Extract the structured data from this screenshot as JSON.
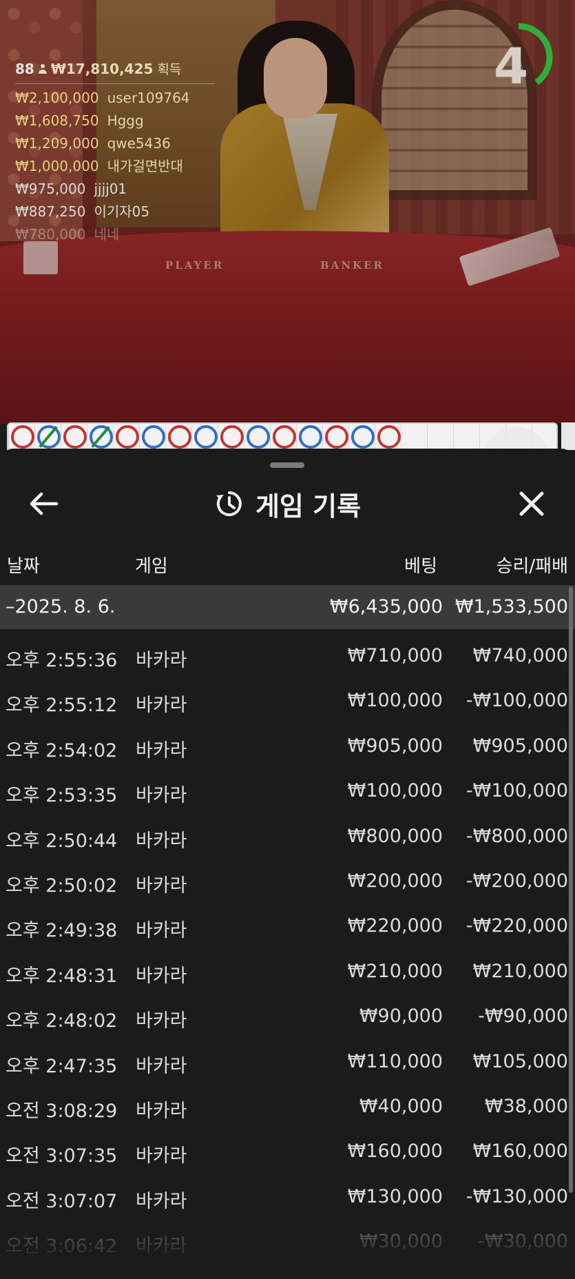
{
  "live": {
    "players_count": "88",
    "total_won": "₩17,810,425",
    "won_label": "획득",
    "countdown": "4",
    "timer_fraction": 0.4,
    "table_labels": {
      "player": "PLAYER",
      "banker": "BANKER"
    },
    "bets": [
      {
        "amount": "₩2,100,000",
        "user": "user109764"
      },
      {
        "amount": "₩1,608,750",
        "user": "Hggg"
      },
      {
        "amount": "₩1,209,000",
        "user": "qwe5436"
      },
      {
        "amount": "₩1,000,000",
        "user": "내가걸면반대"
      },
      {
        "amount": "₩975,000",
        "user": "jjjj01"
      },
      {
        "amount": "₩887,250",
        "user": "이기자05"
      },
      {
        "amount": "₩780,000",
        "user": "네네"
      }
    ],
    "road": [
      "red",
      "blue-slash",
      "red",
      "blue-slash",
      "red",
      "blue",
      "red",
      "blue",
      "red",
      "blue",
      "red",
      "blue",
      "red",
      "blue",
      "red"
    ]
  },
  "sheet": {
    "title": "게임 기록",
    "back_icon": "arrow-left-icon",
    "history_icon": "history-icon",
    "close_icon": "close-icon",
    "columns": {
      "date": "날짜",
      "game": "게임",
      "bet": "베팅",
      "win_loss": "승리/패배"
    },
    "group": {
      "date": "–2025. 8. 6.",
      "bet_total": "₩6,435,000",
      "win_loss_total": "₩1,533,500"
    },
    "rows": [
      {
        "time": "오후 2:55:36",
        "game": "바카라",
        "bet": "₩710,000",
        "win_loss": "₩740,000"
      },
      {
        "time": "오후 2:55:12",
        "game": "바카라",
        "bet": "₩100,000",
        "win_loss": "-₩100,000"
      },
      {
        "time": "오후 2:54:02",
        "game": "바카라",
        "bet": "₩905,000",
        "win_loss": "₩905,000"
      },
      {
        "time": "오후 2:53:35",
        "game": "바카라",
        "bet": "₩100,000",
        "win_loss": "-₩100,000"
      },
      {
        "time": "오후 2:50:44",
        "game": "바카라",
        "bet": "₩800,000",
        "win_loss": "-₩800,000"
      },
      {
        "time": "오후 2:50:02",
        "game": "바카라",
        "bet": "₩200,000",
        "win_loss": "-₩200,000"
      },
      {
        "time": "오후 2:49:38",
        "game": "바카라",
        "bet": "₩220,000",
        "win_loss": "-₩220,000"
      },
      {
        "time": "오후 2:48:31",
        "game": "바카라",
        "bet": "₩210,000",
        "win_loss": "₩210,000"
      },
      {
        "time": "오후 2:48:02",
        "game": "바카라",
        "bet": "₩90,000",
        "win_loss": "-₩90,000"
      },
      {
        "time": "오후 2:47:35",
        "game": "바카라",
        "bet": "₩110,000",
        "win_loss": "₩105,000"
      },
      {
        "time": "오전 3:08:29",
        "game": "바카라",
        "bet": "₩40,000",
        "win_loss": "₩38,000"
      },
      {
        "time": "오전 3:07:35",
        "game": "바카라",
        "bet": "₩160,000",
        "win_loss": "₩160,000"
      },
      {
        "time": "오전 3:07:07",
        "game": "바카라",
        "bet": "₩130,000",
        "win_loss": "-₩130,000"
      },
      {
        "time": "오전 3:06:42",
        "game": "바카라",
        "bet": "₩30,000",
        "win_loss": "-₩30,000"
      }
    ]
  },
  "colors": {
    "sheet_bg": "#1b1b1b",
    "group_row_bg": "#3a3a3a",
    "bet_amount_gold": "#e5d07b",
    "timer_green": "#2fae3c",
    "road_red": "#c63232",
    "road_blue": "#2f6fc8",
    "road_green": "#1f8a3a"
  }
}
